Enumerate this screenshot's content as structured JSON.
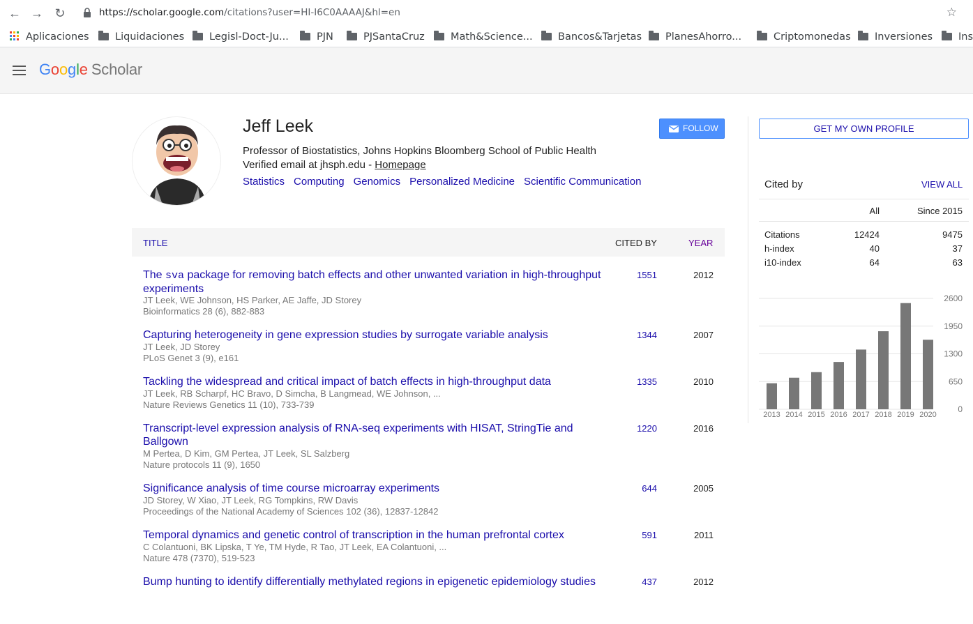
{
  "browser": {
    "url_host": "https://scholar.google.com",
    "url_rest": "/citations?user=HI-I6C0AAAAJ&hl=en",
    "bookmarks": [
      "Aplicaciones",
      "Liquidaciones",
      "Legisl-Doct-Ju...",
      "PJN",
      "PJSantaCruz",
      "Math&Science...",
      "Bancos&Tarjetas",
      "PlanesAhorro...",
      "Criptomonedas",
      "Inversiones",
      "Inst"
    ]
  },
  "header": {
    "logo_google": "Google",
    "logo_scholar": "Scholar"
  },
  "profile": {
    "name": "Jeff Leek",
    "affiliation": "Professor of Biostatistics, Johns Hopkins Bloomberg School of Public Health",
    "email_prefix": "Verified email at jhsph.edu - ",
    "homepage": "Homepage",
    "interests": [
      "Statistics",
      "Computing",
      "Genomics",
      "Personalized Medicine",
      "Scientific Communication"
    ],
    "follow_label": "FOLLOW"
  },
  "table": {
    "col_title": "TITLE",
    "col_cited": "CITED BY",
    "col_year": "YEAR",
    "rows": [
      {
        "title_pre": "The ",
        "title_code": "sva",
        "title_post": " package for removing batch effects and other unwanted variation in high-throughput experiments",
        "authors": "JT Leek, WE Johnson, HS Parker, AE Jaffe, JD Storey",
        "pub": "Bioinformatics 28 (6), 882-883",
        "cited": "1551",
        "year": "2012"
      },
      {
        "title": "Capturing heterogeneity in gene expression studies by surrogate variable analysis",
        "authors": "JT Leek, JD Storey",
        "pub": "PLoS Genet 3 (9), e161",
        "cited": "1344",
        "year": "2007"
      },
      {
        "title": "Tackling the widespread and critical impact of batch effects in high-throughput data",
        "authors": "JT Leek, RB Scharpf, HC Bravo, D Simcha, B Langmead, WE Johnson, ...",
        "pub": "Nature Reviews Genetics 11 (10), 733-739",
        "cited": "1335",
        "year": "2010"
      },
      {
        "title": "Transcript-level expression analysis of RNA-seq experiments with HISAT, StringTie and Ballgown",
        "authors": "M Pertea, D Kim, GM Pertea, JT Leek, SL Salzberg",
        "pub": "Nature protocols 11 (9), 1650",
        "cited": "1220",
        "year": "2016"
      },
      {
        "title": "Significance analysis of time course microarray experiments",
        "authors": "JD Storey, W Xiao, JT Leek, RG Tompkins, RW Davis",
        "pub": "Proceedings of the National Academy of Sciences 102 (36), 12837-12842",
        "cited": "644",
        "year": "2005"
      },
      {
        "title": "Temporal dynamics and genetic control of transcription in the human prefrontal cortex",
        "authors": "C Colantuoni, BK Lipska, T Ye, TM Hyde, R Tao, JT Leek, EA Colantuoni, ...",
        "pub": "Nature 478 (7370), 519-523",
        "cited": "591",
        "year": "2011"
      },
      {
        "title": "Bump hunting to identify differentially methylated regions in epigenetic epidemiology studies",
        "authors": "",
        "pub": "",
        "cited": "437",
        "year": "2012"
      }
    ]
  },
  "sidebar": {
    "own_profile": "GET MY OWN PROFILE",
    "cited_by": "Cited by",
    "view_all": "VIEW ALL",
    "col_all": "All",
    "col_since": "Since 2015",
    "stats": [
      {
        "label": "Citations",
        "all": "12424",
        "since": "9475"
      },
      {
        "label": "h-index",
        "all": "40",
        "since": "37"
      },
      {
        "label": "i10-index",
        "all": "64",
        "since": "63"
      }
    ]
  },
  "chart_data": {
    "type": "bar",
    "categories": [
      "2013",
      "2014",
      "2015",
      "2016",
      "2017",
      "2018",
      "2019",
      "2020"
    ],
    "values": [
      610,
      740,
      870,
      1110,
      1400,
      1830,
      2490,
      1630
    ],
    "ylim": [
      0,
      2600
    ],
    "yticks": [
      "2600",
      "1950",
      "1300",
      "650",
      "0"
    ],
    "bar_color": "#777777"
  }
}
